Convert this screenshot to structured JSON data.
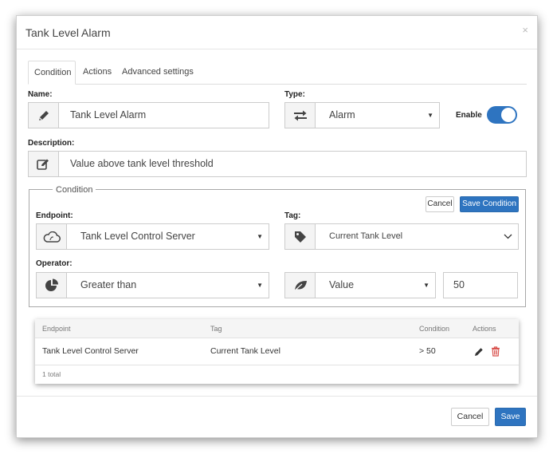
{
  "dialog": {
    "title": "Tank Level Alarm",
    "close_glyph": "×"
  },
  "tabs": [
    {
      "label": "Condition",
      "active": true
    },
    {
      "label": "Actions",
      "active": false
    },
    {
      "label": "Advanced settings",
      "active": false
    }
  ],
  "form": {
    "name_label": "Name:",
    "name_value": "Tank Level Alarm",
    "type_label": "Type:",
    "type_value": "Alarm",
    "enable_label": "Enable",
    "enable_on": true,
    "description_label": "Description:",
    "description_value": "Value above tank level threshold"
  },
  "condition": {
    "legend": "Condition",
    "cancel_label": "Cancel",
    "save_label": "Save Condition",
    "endpoint_label": "Endpoint:",
    "endpoint_value": "Tank Level Control Server",
    "tag_label": "Tag:",
    "tag_value": "Current Tank Level",
    "operator_label": "Operator:",
    "operator_value": "Greater than",
    "value_type": "Value",
    "value_input": "50"
  },
  "table": {
    "headers": [
      "Endpoint",
      "Tag",
      "Condition",
      "Actions"
    ],
    "rows": [
      {
        "endpoint": "Tank Level Control Server",
        "tag": "Current Tank Level",
        "condition": "> 50"
      }
    ],
    "footer": "1 total"
  },
  "footer": {
    "cancel_label": "Cancel",
    "save_label": "Save"
  },
  "colors": {
    "accent": "#2e74c0",
    "delete": "#d9534f"
  },
  "icons": [
    "pencil-icon",
    "exchange-icon",
    "edit-square-icon",
    "cloud-icon",
    "tag-icon",
    "pie-chart-icon",
    "leaf-icon",
    "edit-icon",
    "trash-icon"
  ]
}
